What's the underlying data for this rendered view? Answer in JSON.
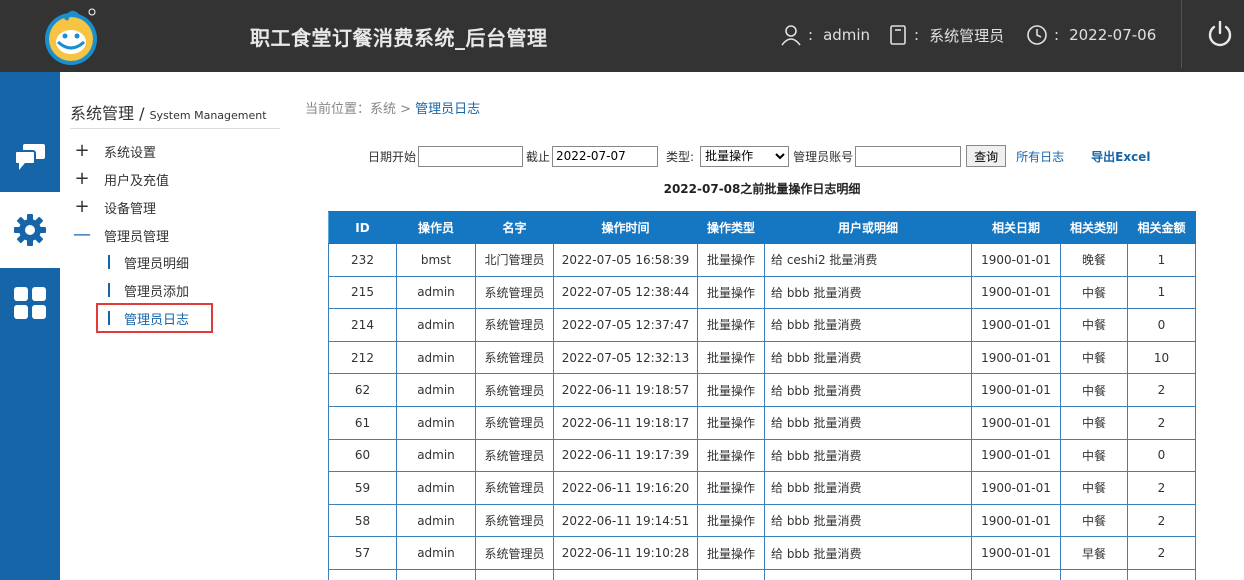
{
  "header": {
    "app_title": "职工食堂订餐消费系统_后台管理",
    "user_label": "admin",
    "role_label": "系统管理员",
    "date_label": "2022-07-06",
    "colon": ":"
  },
  "rail": {
    "items": [
      "message-icon",
      "gear-icon",
      "grid-icon"
    ],
    "active": "gear-icon"
  },
  "sidebar": {
    "title_cn": "系统管理 /",
    "title_en": "System Management",
    "menus": [
      {
        "label": "系统设置",
        "marker": "+"
      },
      {
        "label": "用户及充值",
        "marker": "+"
      },
      {
        "label": "设备管理",
        "marker": "+"
      },
      {
        "label": "管理员管理",
        "marker": "—"
      }
    ],
    "sub_items": [
      {
        "label": "管理员明细"
      },
      {
        "label": "管理员添加"
      },
      {
        "label": "管理员日志"
      }
    ]
  },
  "breadcrumb": {
    "prefix": "当前位置：系统 > ",
    "current": "管理员日志"
  },
  "filter": {
    "start_label": "日期开始",
    "start_value": "",
    "end_label": "截止",
    "end_value": "2022-07-07",
    "type_label": "类型:",
    "type_selected": "批量操作",
    "account_label": "管理员账号",
    "account_value": "",
    "query_button": "查询",
    "all_logs_link": "所有日志",
    "export_link": "导出Excel"
  },
  "table": {
    "caption": "2022-07-08之前批量操作日志明细",
    "headers": [
      "ID",
      "操作员",
      "名字",
      "操作时间",
      "操作类型",
      "用户或明细",
      "相关日期",
      "相关类别",
      "相关金额"
    ],
    "rows": [
      [
        "232",
        "bmst",
        "北门管理员",
        "2022-07-05 16:58:39",
        "批量操作",
        "给 ceshi2 批量消费",
        "1900-01-01",
        "晚餐",
        "1"
      ],
      [
        "215",
        "admin",
        "系统管理员",
        "2022-07-05 12:38:44",
        "批量操作",
        "给 bbb 批量消费",
        "1900-01-01",
        "中餐",
        "1"
      ],
      [
        "214",
        "admin",
        "系统管理员",
        "2022-07-05 12:37:47",
        "批量操作",
        "给 bbb 批量消费",
        "1900-01-01",
        "中餐",
        "0"
      ],
      [
        "212",
        "admin",
        "系统管理员",
        "2022-07-05 12:32:13",
        "批量操作",
        "给 bbb 批量消费",
        "1900-01-01",
        "中餐",
        "10"
      ],
      [
        "62",
        "admin",
        "系统管理员",
        "2022-06-11 19:18:57",
        "批量操作",
        "给 bbb 批量消费",
        "1900-01-01",
        "中餐",
        "2"
      ],
      [
        "61",
        "admin",
        "系统管理员",
        "2022-06-11 19:18:17",
        "批量操作",
        "给 bbb 批量消费",
        "1900-01-01",
        "中餐",
        "2"
      ],
      [
        "60",
        "admin",
        "系统管理员",
        "2022-06-11 19:17:39",
        "批量操作",
        "给 bbb 批量消费",
        "1900-01-01",
        "中餐",
        "0"
      ],
      [
        "59",
        "admin",
        "系统管理员",
        "2022-06-11 19:16:20",
        "批量操作",
        "给 bbb 批量消费",
        "1900-01-01",
        "中餐",
        "2"
      ],
      [
        "58",
        "admin",
        "系统管理员",
        "2022-06-11 19:14:51",
        "批量操作",
        "给 bbb 批量消费",
        "1900-01-01",
        "中餐",
        "2"
      ],
      [
        "57",
        "admin",
        "系统管理员",
        "2022-06-11 19:10:28",
        "批量操作",
        "给 bbb 批量消费",
        "1900-01-01",
        "早餐",
        "2"
      ],
      [
        "",
        "",
        "",
        "",
        "",
        "",
        "",
        "",
        ""
      ]
    ]
  },
  "colors": {
    "header_bg": "#333333",
    "rail_bg": "#1565a8",
    "table_header_bg": "#1577c2",
    "link": "#1565a8",
    "highlight_box": "#e03c3c"
  }
}
